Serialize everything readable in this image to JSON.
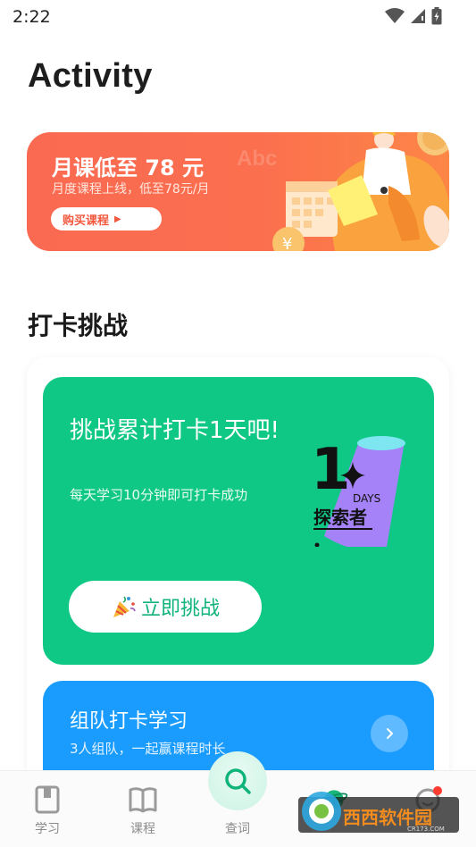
{
  "status_bar": {
    "time": "2:22"
  },
  "page": {
    "title": "Activity"
  },
  "promo": {
    "title": "月课低至 78 元",
    "subtitle": "月度课程上线，低至78元/月",
    "button_label": "购买课程",
    "art_text": "Abc"
  },
  "challenge": {
    "section_title": "打卡挑战",
    "title": "挑战累计打卡1天吧!",
    "subtitle": "每天学习10分钟即可打卡成功",
    "button_label": "立即挑战",
    "badge": {
      "number": "1",
      "days": "DAYS",
      "label": "探索者"
    }
  },
  "team": {
    "title": "组队打卡学习",
    "subtitle": "3人组队，一起赢课程时长"
  },
  "bottom_nav": {
    "items": [
      {
        "label": "学习",
        "icon": "notebook-icon"
      },
      {
        "label": "课程",
        "icon": "book-icon"
      },
      {
        "label": "查词",
        "icon": "search-icon"
      },
      {
        "label": "",
        "icon": "planet-icon"
      },
      {
        "label": "",
        "icon": "profile-icon"
      }
    ]
  },
  "watermark": {
    "text": "西西软件园",
    "sub": "CR173.COM"
  },
  "colors": {
    "promo": "#fa6a52",
    "green": "#10c886",
    "blue": "#1a9cff",
    "nav_label": "#8c8c8c",
    "notification_dot": "#ff3b30"
  }
}
